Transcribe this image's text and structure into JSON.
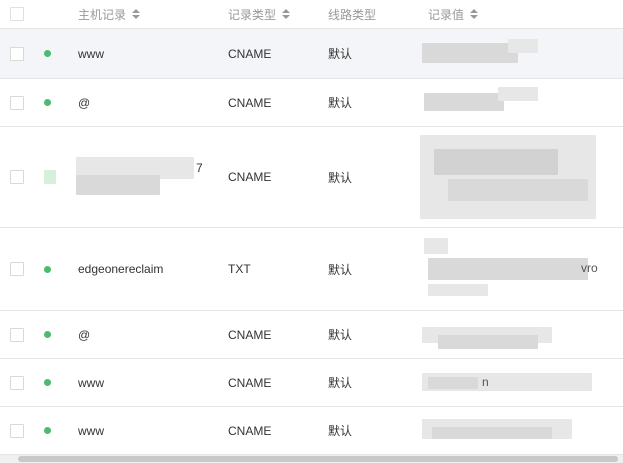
{
  "columns": {
    "host": "主机记录",
    "type": "记录类型",
    "line": "线路类型",
    "value": "记录值"
  },
  "rows": [
    {
      "host": "www",
      "type": "CNAME",
      "line": "默认",
      "value_suffix": ""
    },
    {
      "host": "@",
      "type": "CNAME",
      "line": "默认",
      "value_suffix": ""
    },
    {
      "host": "7",
      "type": "CNAME",
      "line": "默认",
      "value_suffix": ""
    },
    {
      "host": "edgeonereclaim",
      "type": "TXT",
      "line": "默认",
      "value_suffix": "vro"
    },
    {
      "host": "@",
      "type": "CNAME",
      "line": "默认",
      "value_suffix": ""
    },
    {
      "host": "www",
      "type": "CNAME",
      "line": "默认",
      "value_suffix": "n"
    },
    {
      "host": "www",
      "type": "CNAME",
      "line": "默认",
      "value_suffix": ""
    }
  ],
  "colors": {
    "status_ok": "#4cbb6c",
    "header_text": "#999999",
    "row_highlight": "#f4f5f8"
  }
}
